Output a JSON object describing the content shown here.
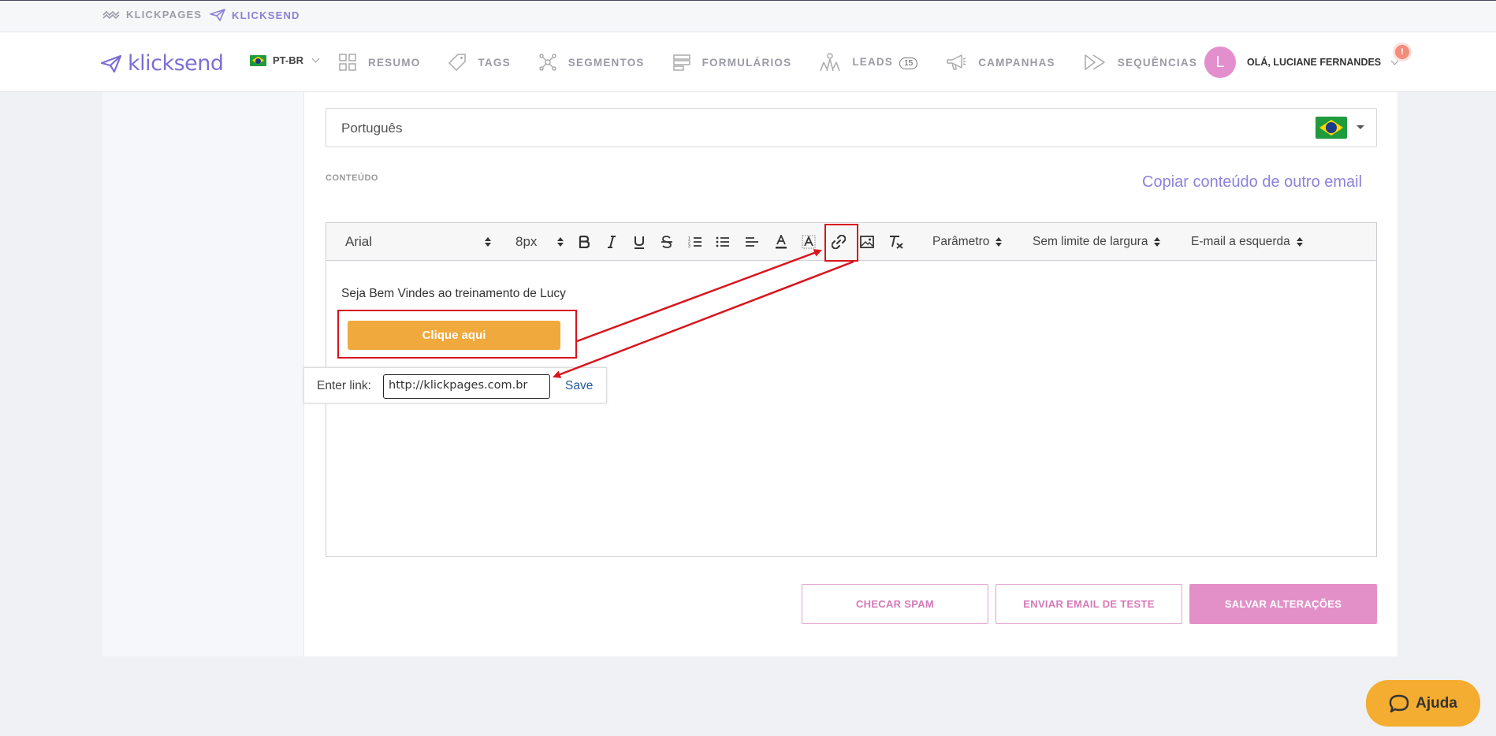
{
  "topbar": {
    "klickpages_label": "KLICKPAGES",
    "klicksend_label": "KLICKSEND"
  },
  "nav": {
    "logo_text": "klicksend",
    "lang_label": "PT-BR",
    "menu": [
      {
        "label": "RESUMO",
        "icon": "grid-icon"
      },
      {
        "label": "TAGS",
        "icon": "tag-icon"
      },
      {
        "label": "SEGMENTOS",
        "icon": "network-icon"
      },
      {
        "label": "FORMULÁRIOS",
        "icon": "form-icon"
      },
      {
        "label": "LEADS",
        "icon": "users-icon",
        "count": "15"
      },
      {
        "label": "CAMPANHAS",
        "icon": "megaphone-icon"
      },
      {
        "label": "SEQUÊNCIAS",
        "icon": "sequence-icon"
      }
    ],
    "avatar_letter": "L",
    "user_greeting": "OLÁ, LUCIANE FERNANDES",
    "notification_badge": "!"
  },
  "language_select": {
    "value": "Português"
  },
  "content": {
    "section_label": "CONTEÚDO",
    "copy_link": "Copiar conteúdo de outro email"
  },
  "editor": {
    "font_family": "Arial",
    "font_size": "8px",
    "param_select": "Parâmetro",
    "width_select": "Sem limite de largura",
    "align_select": "E-mail a esquerda",
    "body_text": "Seja Bem Vindes ao treinamento de Lucy",
    "cta_label": "Clique aqui"
  },
  "link_popup": {
    "label": "Enter link:",
    "value": "http://klickpages.com.br",
    "save_label": "Save"
  },
  "actions": {
    "check_spam": "CHECAR SPAM",
    "send_test": "ENVIAR EMAIL DE TESTE",
    "save_changes": "SALVAR ALTERAÇÕES"
  },
  "help": {
    "label": "Ajuda"
  },
  "colors": {
    "brand_purple": "#7c6fd4",
    "accent_pink": "#e390c9",
    "cta_orange": "#f0a93c",
    "annotation_red": "#d9141c"
  }
}
